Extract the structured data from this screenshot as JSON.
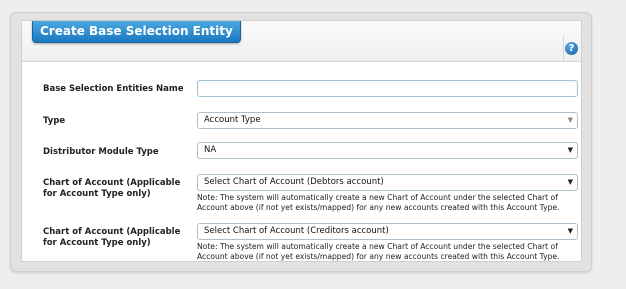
{
  "panel": {
    "title": "Create Base Selection Entity",
    "help_symbol": "?"
  },
  "form": {
    "name_label": "Base Selection Entities Name",
    "name_value": "",
    "type_label": "Type",
    "type_value": "Account Type",
    "distributor_label": "Distributor Module Type",
    "distributor_value": "NA",
    "coa_debtors_label": "Chart of Account (Applicable for Account Type only)",
    "coa_debtors_value": "Select Chart of Account (Debtors account)",
    "coa_debtors_note": "Note: The system will automatically create a new Chart of Account under the selected Chart of Account above (if not yet exists/mapped) for any new accounts created with this Account Type.",
    "coa_creditors_label": "Chart of Account (Applicable for Account Type only)",
    "coa_creditors_value": "Select Chart of Account (Creditors account)",
    "coa_creditors_note": "Note: The system will automatically create a new Chart of Account under the selected Chart of Account above (if not yet exists/mapped) for any new accounts created with this Account Type."
  },
  "icons": {
    "dropdown": "chevron-down-icon",
    "help": "help-icon"
  },
  "colors": {
    "title_tab": "#1b78c2",
    "help_icon": "#1c5fa8",
    "field_border": "#aebfcc"
  }
}
